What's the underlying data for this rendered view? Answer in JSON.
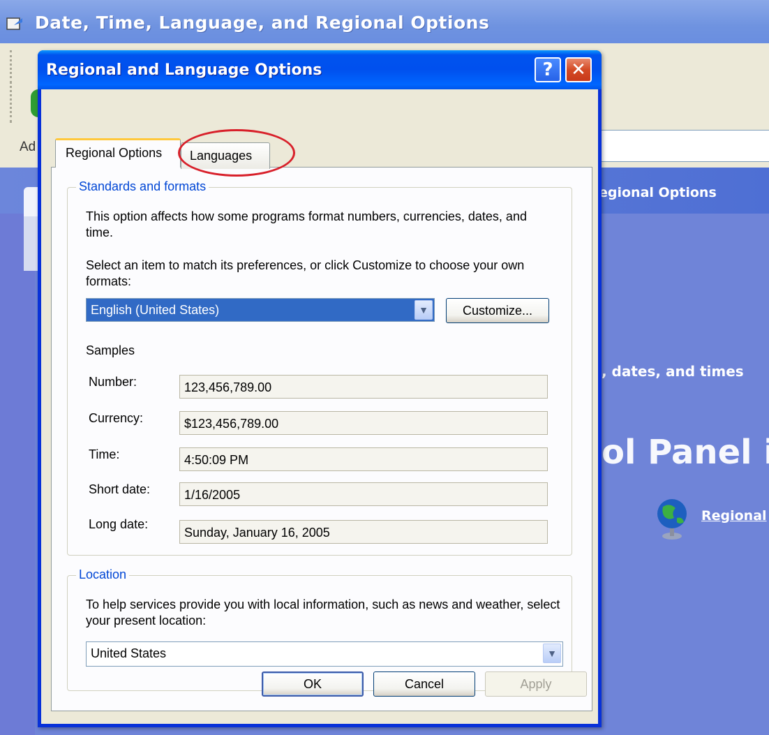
{
  "background_window": {
    "title": "Date, Time, Language, and Regional Options",
    "address_label": "Ad",
    "header_text": "egional Options",
    "subheading": ", dates, and times",
    "big_heading": "ol Panel i",
    "link_text": "Regional"
  },
  "dialog": {
    "title": "Regional and Language Options",
    "help_label": "?",
    "close_label": "✕",
    "tabs": [
      {
        "label": "Regional Options",
        "active": true
      },
      {
        "label": "Languages",
        "active": false
      }
    ],
    "standards": {
      "legend": "Standards and formats",
      "description": "This option affects how some programs format numbers, currencies, dates, and time.",
      "instruction": "Select an item to match its preferences, or click Customize to choose your own formats:",
      "selected_locale": "English (United States)",
      "customize_label": "Customize...",
      "samples_heading": "Samples",
      "samples": [
        {
          "label": "Number:",
          "value": "123,456,789.00"
        },
        {
          "label": "Currency:",
          "value": "$123,456,789.00"
        },
        {
          "label": "Time:",
          "value": "4:50:09 PM"
        },
        {
          "label": "Short date:",
          "value": "1/16/2005"
        },
        {
          "label": "Long date:",
          "value": "Sunday, January 16, 2005"
        }
      ]
    },
    "location": {
      "legend": "Location",
      "description": "To help services provide you with local information, such as news and weather, select your present location:",
      "selected": "United States"
    },
    "buttons": {
      "ok": "OK",
      "cancel": "Cancel",
      "apply": "Apply"
    }
  },
  "colors": {
    "title_bar": "#0054e3",
    "panel_background": "#6f84d8",
    "highlight_circle": "#d8202a",
    "selection": "#316ac5",
    "group_legend": "#0046d5"
  },
  "icons": {
    "dropdown_arrow": "chevron-down-icon",
    "globe": "globe-icon",
    "control_panel": "control-panel-icon"
  }
}
